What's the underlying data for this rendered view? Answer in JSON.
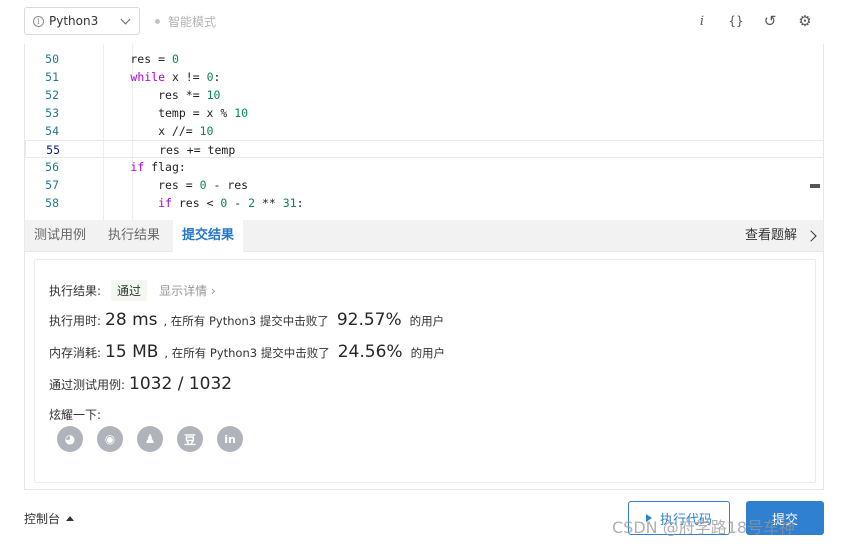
{
  "toolbar": {
    "language": "Python3",
    "mode": "智能模式",
    "icons": [
      "info-icon",
      "braces-icon",
      "reset-icon",
      "settings-icon"
    ],
    "info_glyph": "i",
    "braces_glyph": "{}",
    "reset_glyph": "↺",
    "settings_glyph": "⚙"
  },
  "editor": {
    "lines": [
      {
        "n": "50",
        "code": "        res = 0"
      },
      {
        "n": "51",
        "code": "        while x != 0:"
      },
      {
        "n": "52",
        "code": "            res *= 10"
      },
      {
        "n": "53",
        "code": "            temp = x % 10"
      },
      {
        "n": "54",
        "code": "            x //= 10"
      },
      {
        "n": "55",
        "code": "            res += temp"
      },
      {
        "n": "56",
        "code": "        if flag:"
      },
      {
        "n": "57",
        "code": "            res = 0 - res"
      },
      {
        "n": "58",
        "code": "            if res < 0 - 2 ** 31:"
      }
    ],
    "active_line": "55"
  },
  "tabs": [
    {
      "label": "测试用例",
      "active": false
    },
    {
      "label": "执行结果",
      "active": false
    },
    {
      "label": "提交结果",
      "active": true
    }
  ],
  "view_solution": "查看题解",
  "result": {
    "status_label": "执行结果:",
    "status": "通过",
    "details": "显示详情 ›",
    "runtime_label": "执行用时:",
    "runtime": "28 ms",
    "runtime_mid": ", 在所有 Python3 提交中击败了",
    "runtime_pct": "92.57%",
    "users": "的用户",
    "memory_label": "内存消耗:",
    "memory": "15 MB",
    "memory_mid": ", 在所有 Python3 提交中击败了",
    "memory_pct": "24.56%",
    "tests_label": "通过测试用例:",
    "tests": "1032 / 1032",
    "share_label": "炫耀一下:",
    "share_icons": [
      {
        "name": "wechat-icon",
        "glyph": "◕"
      },
      {
        "name": "weibo-icon",
        "glyph": "◉"
      },
      {
        "name": "qq-icon",
        "glyph": "♟"
      },
      {
        "name": "douban-icon",
        "glyph": "豆"
      },
      {
        "name": "linkedin-icon",
        "glyph": "in"
      }
    ]
  },
  "footer": {
    "console": "控制台",
    "run": "执行代码",
    "submit": "提交",
    "watermark": "CSDN @府学路18号车神"
  },
  "colors": {
    "accent": "#2f80d1",
    "keyword": "#af00db",
    "number": "#098658",
    "line_number": "#237893"
  }
}
